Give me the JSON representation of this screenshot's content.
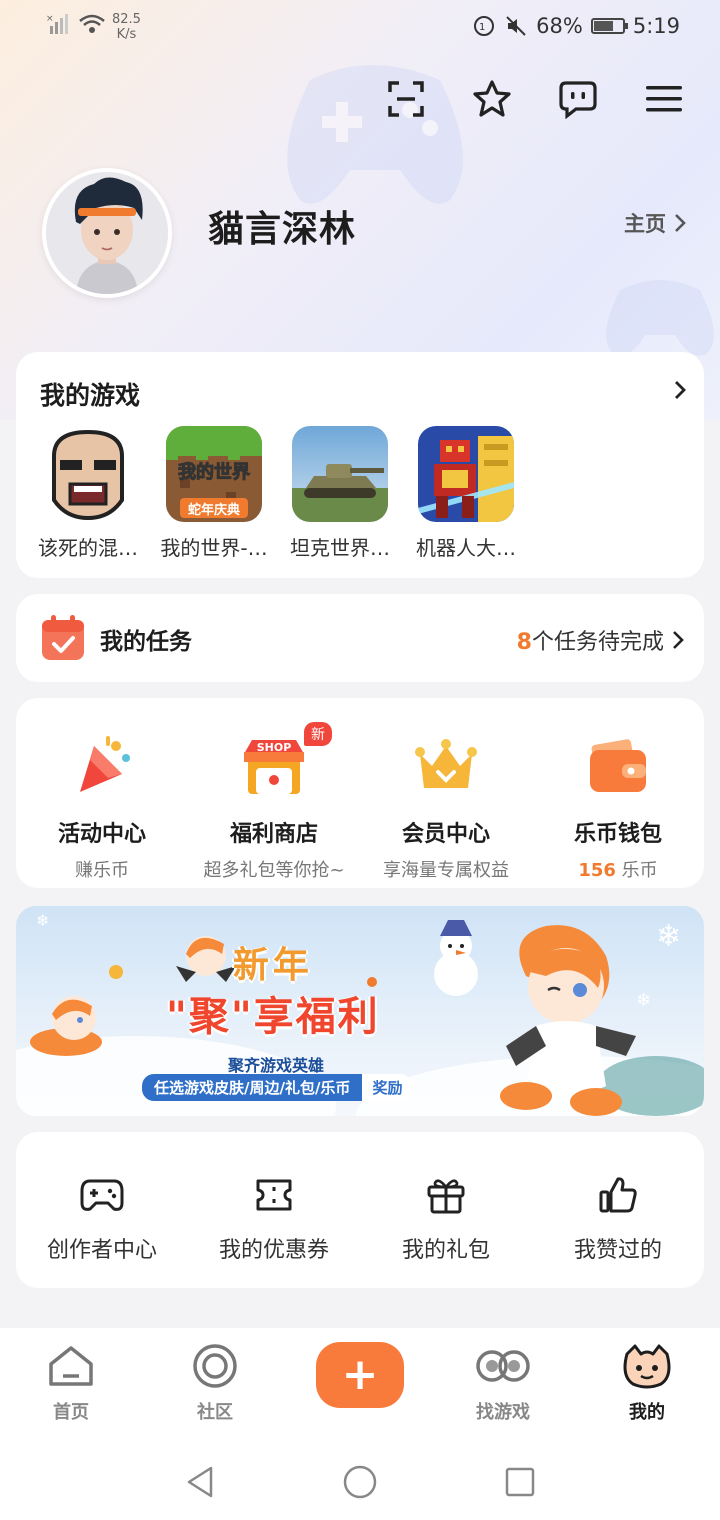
{
  "status_bar": {
    "speed_value": "82.5",
    "speed_unit": "K/s",
    "battery": "68%",
    "battery_level": 0.68,
    "time": "5:19"
  },
  "header": {
    "icons": [
      "scan-icon",
      "star-icon",
      "message-icon",
      "menu-icon"
    ]
  },
  "profile": {
    "username": "貓言深林",
    "home_label": "主页"
  },
  "my_games": {
    "title": "我的游戏",
    "items": [
      {
        "name": "该死的混…"
      },
      {
        "name": "我的世界-…",
        "icon_text_1": "我的世界",
        "icon_text_2": "蛇年庆典"
      },
      {
        "name": "坦克世界…"
      },
      {
        "name": "机器人大…"
      }
    ]
  },
  "tasks": {
    "title": "我的任务",
    "count": "8",
    "suffix": "个任务待完成"
  },
  "services": {
    "items": [
      {
        "name": "活动中心",
        "sub": "赚乐币"
      },
      {
        "name": "福利商店",
        "sub": "超多礼包等你抢~",
        "badge": "新",
        "icon_text": "SHOP"
      },
      {
        "name": "会员中心",
        "sub": "享海量专属权益"
      },
      {
        "name": "乐币钱包",
        "coins": "156",
        "coins_unit": "乐币"
      }
    ]
  },
  "banner": {
    "line1": "新年",
    "line2": "\"聚\"享福利",
    "sub1": "聚齐游戏英雄",
    "sub2": "任选游戏皮肤/周边/礼包/乐币",
    "sub2_end": "奖励"
  },
  "tools": {
    "items": [
      {
        "name": "创作者中心"
      },
      {
        "name": "我的优惠券"
      },
      {
        "name": "我的礼包"
      },
      {
        "name": "我赞过的"
      }
    ]
  },
  "bottom_nav": {
    "items": [
      {
        "label": "首页"
      },
      {
        "label": "社区"
      },
      {
        "label": "找游戏"
      },
      {
        "label": "我的"
      }
    ],
    "fab": "+",
    "active": "我的"
  },
  "colors": {
    "accent": "#f97b3c",
    "count_orange": "#f07a2d",
    "badge_red": "#f0463c"
  }
}
